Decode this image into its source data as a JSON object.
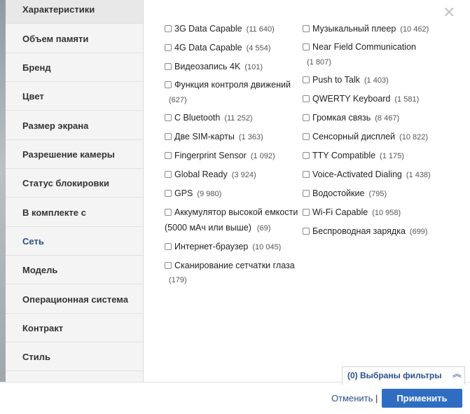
{
  "sidebar": {
    "items": [
      {
        "label": "Характеристики"
      },
      {
        "label": "Объем памяти"
      },
      {
        "label": "Бренд"
      },
      {
        "label": "Цвет"
      },
      {
        "label": "Размер экрана"
      },
      {
        "label": "Разрешение камеры"
      },
      {
        "label": "Статус блокировки"
      },
      {
        "label": "В комплекте с"
      },
      {
        "label": "Сеть"
      },
      {
        "label": "Модель"
      },
      {
        "label": "Операционная система"
      },
      {
        "label": "Контракт"
      },
      {
        "label": "Стиль"
      }
    ],
    "active": "Сеть"
  },
  "close_icon": "✕",
  "left_column": [
    {
      "label": "3G Data Capable",
      "count": "(11 640)"
    },
    {
      "label": "4G Data Capable",
      "count": "(4 554)"
    },
    {
      "label": "Видеозапись 4K",
      "count": "(101)"
    },
    {
      "label": "Функция контроля движений",
      "count": "(627)"
    },
    {
      "label": "С Bluetooth",
      "count": "(11 252)"
    },
    {
      "label": "Две SIM-карты",
      "count": "(1 363)"
    },
    {
      "label": "Fingerprint Sensor",
      "count": "(1 092)"
    },
    {
      "label": "Global Ready",
      "count": "(3 924)"
    },
    {
      "label": "GPS",
      "count": "(9 980)"
    },
    {
      "label_line1": "Аккумулятор высокой емкости",
      "label_line2": "(5000 мАч или выше)",
      "count": "(69)"
    },
    {
      "label": "Интернет-браузер",
      "count": "(10 045)"
    },
    {
      "label": "Сканирование сетчатки глаза",
      "count": "(179)"
    }
  ],
  "right_column": [
    {
      "label": "Музыкальный плеер",
      "count": "(10 462)"
    },
    {
      "label": "Near Field Communication",
      "count": "(1 807)"
    },
    {
      "label": "Push to Talk",
      "count": "(1 403)"
    },
    {
      "label": "QWERTY Keyboard",
      "count": "(1 581)"
    },
    {
      "label": "Громкая связь",
      "count": "(8 467)"
    },
    {
      "label": "Сенсорный дисплей",
      "count": "(10 822)"
    },
    {
      "label": "TTY Compatible",
      "count": "(1 175)"
    },
    {
      "label": "Voice-Activated Dialing",
      "count": "(1 438)"
    },
    {
      "label": "Водостойкие",
      "count": "(795)"
    },
    {
      "label": "Wi-Fi Capable",
      "count": "(10 958)"
    },
    {
      "label": "Беспроводная зарядка",
      "count": "(699)"
    }
  ],
  "footer": {
    "selected_filters": "(0) Выбраны фильтры",
    "chevron_icon": "︽",
    "cancel_label": "Отменить",
    "separator": "|",
    "apply_label": "Применить"
  },
  "colors": {
    "accent": "#2a4f8c",
    "apply_button": "#2f6dc2"
  }
}
